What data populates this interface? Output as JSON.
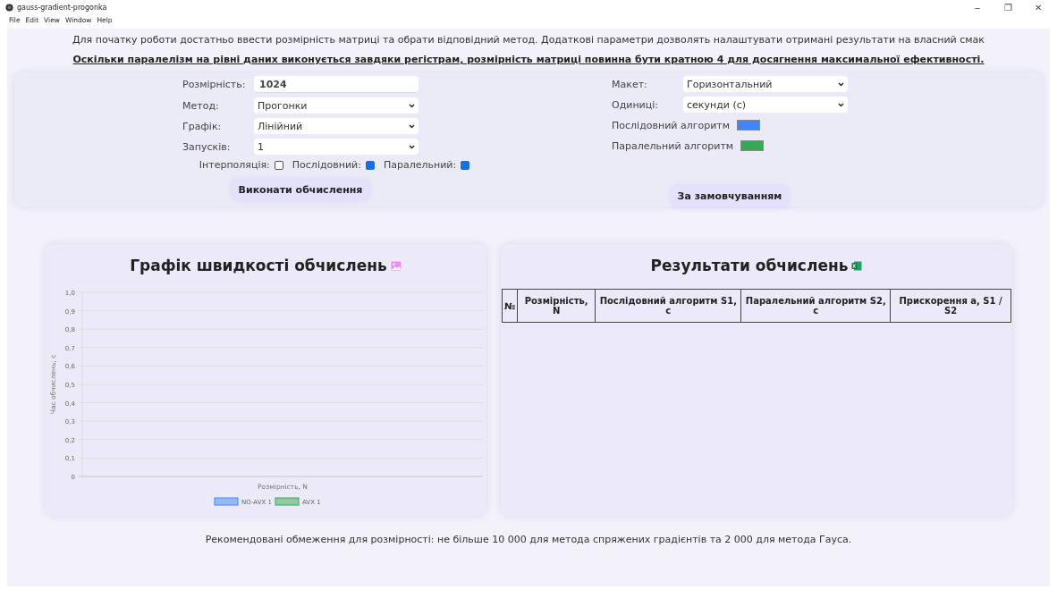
{
  "window": {
    "title": "gauss-gradient-progonka",
    "controls": [
      "–",
      "❐",
      "✕"
    ]
  },
  "menu": [
    "File",
    "Edit",
    "View",
    "Window",
    "Help"
  ],
  "intro": "Для початку роботи достатньо ввести розмірність матриці та обрати відповідний метод. Додаткові параметри дозволять налаштувати отримані результати на власний смак",
  "notice": "Оскільки паралелізм на рівні даних виконується завдяки регістрам, розмірність матриці повинна бути кратною 4 для досягнення максимальної ефективності.",
  "left_form": {
    "fields": [
      {
        "kind": "input",
        "label": "Розмірність:",
        "value": "1024"
      },
      {
        "kind": "select",
        "label": "Метод:",
        "value": "Прогонки"
      },
      {
        "kind": "select",
        "label": "Графік:",
        "value": "Лінійний"
      },
      {
        "kind": "select",
        "label": "Запусків:",
        "value": "1"
      }
    ],
    "checks": [
      {
        "label": "Інтерполяція:",
        "checked": false
      },
      {
        "label": "Послідовний:",
        "checked": true
      },
      {
        "label": "Паралельний:",
        "checked": true
      }
    ],
    "button": "Виконати обчислення"
  },
  "right_form": {
    "fields": [
      {
        "kind": "select",
        "label": "Макет:",
        "value": "Горизонтальний"
      },
      {
        "kind": "select",
        "label": "Одиниці:",
        "value": "секунди (с)"
      },
      {
        "kind": "swatch",
        "label": "Послідовний алгоритм",
        "color": "#4285f4"
      },
      {
        "kind": "swatch",
        "label": "Паралельний алгоритм",
        "color": "#34a853"
      }
    ],
    "button": "За замовчуванням"
  },
  "chart_panel": {
    "title": "Графік швидкості обчислень",
    "chart_data": {
      "type": "line",
      "grid": true,
      "xlabel": "Розмірність, N",
      "ylabel": "Час обчислень, с",
      "ylim": [
        0,
        1
      ],
      "yticks": [
        {
          "value": 0,
          "label": "0"
        },
        {
          "value": 0.1,
          "label": "0,1"
        },
        {
          "value": 0.2,
          "label": "0,2"
        },
        {
          "value": 0.3,
          "label": "0,3"
        },
        {
          "value": 0.4,
          "label": "0,4"
        },
        {
          "value": 0.5,
          "label": "0,5"
        },
        {
          "value": 0.6,
          "label": "0,6"
        },
        {
          "value": 0.7,
          "label": "0,7"
        },
        {
          "value": 0.8,
          "label": "0,8"
        },
        {
          "value": 0.9,
          "label": "0,9"
        },
        {
          "value": 1,
          "label": "1,0"
        }
      ],
      "series": [
        {
          "name": "NO-AVX 1",
          "color": "#4285f4"
        },
        {
          "name": "AVX 1",
          "color": "#34a853"
        }
      ]
    }
  },
  "table_panel": {
    "title": "Результати обчислень",
    "columns": [
      "№",
      "Розмірність, N",
      "Послідовний алгоритм S1, с",
      "Паралельний алгоритм S2, с",
      "Прискорення a, S1 / S2"
    ]
  },
  "footer": "Рекомендовані обмеження для розмірності: не більше 10 000 для метода спряжених градієнтів та 2 000 для метода Гауса."
}
